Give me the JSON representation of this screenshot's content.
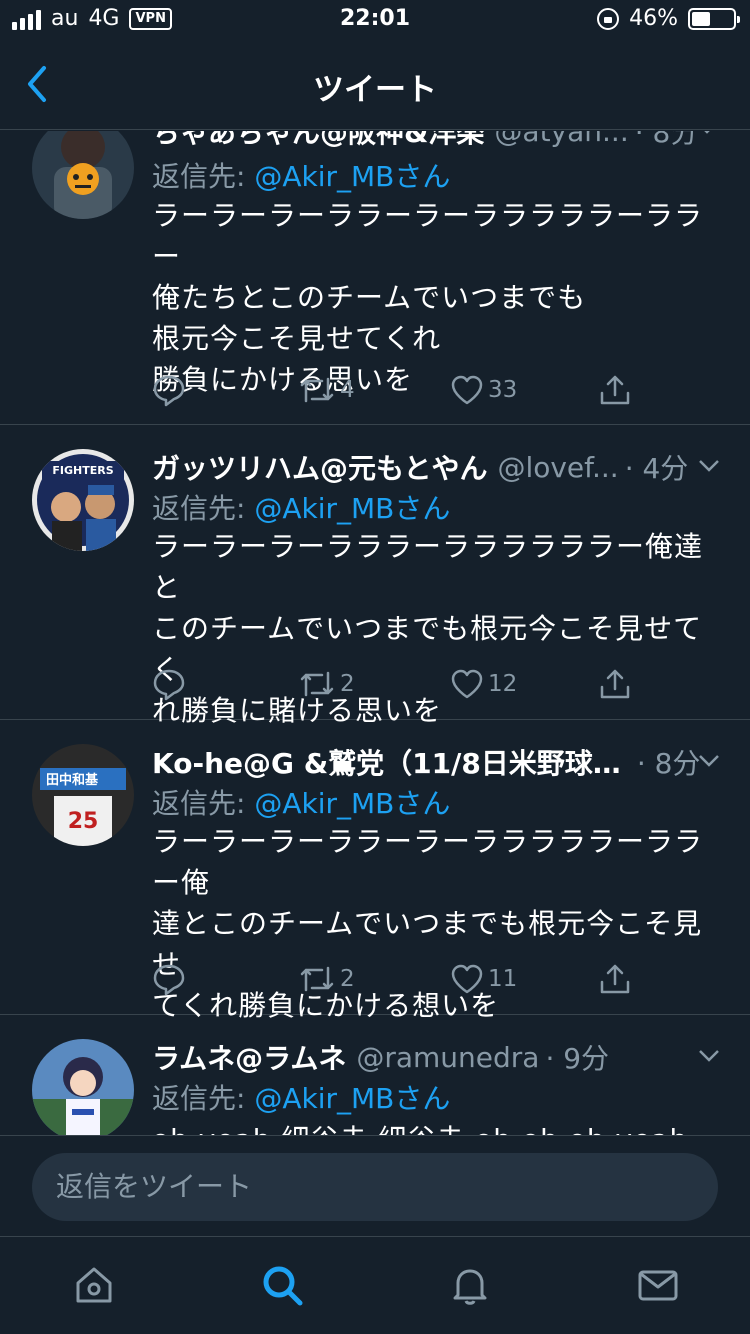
{
  "status": {
    "carrier": "au",
    "network": "4G",
    "vpn": "VPN",
    "time": "22:01",
    "battery_percent": "46%",
    "battery_level": 0.46
  },
  "nav": {
    "title": "ツイート"
  },
  "tweets": [
    {
      "name": "ちゃあちゃん@阪神&洋楽",
      "handle": "@atyan...",
      "time": "· 8分",
      "reply_prefix": "返信先:",
      "reply_to": "@Akir_MBさん",
      "text": "ラーラーラーララーラーラララララーララー\n俺たちとこのチームでいつまでも\n根元今こそ見せてくれ\n勝負にかける思いを",
      "retweets": "4",
      "likes": "33"
    },
    {
      "name": "ガッツリハム@元もとやん",
      "handle": "@lovef...",
      "time": "· 4分",
      "reply_prefix": "返信先:",
      "reply_to": "@Akir_MBさん",
      "text": "ラーラーラーラララーララララララー俺達と\nこのチームでいつまでも根元今こそ見せてく\nれ勝負に賭ける思いを",
      "retweets": "2",
      "likes": "12"
    },
    {
      "name": "Ko-he@G &鷲党（11/8日米野球…",
      "handle": "",
      "time": "· 8分",
      "reply_prefix": "返信先:",
      "reply_to": "@Akir_MBさん",
      "text": "ラーラーラーララーラーラララララーララー俺\n達とこのチームでいつまでも根元今こそ見せ\nてくれ勝負にかける想いを",
      "retweets": "2",
      "likes": "11"
    },
    {
      "name": "ラムネ@ラムネ",
      "handle": "@ramunedra",
      "time": "· 9分",
      "reply_prefix": "返信先:",
      "reply_to": "@Akir_MBさん",
      "text": "oh yeah 細谷圭 細谷圭 oh oh oh yeah 細",
      "retweets": "",
      "likes": ""
    }
  ],
  "compose": {
    "placeholder": "返信をツイート"
  },
  "tabs": [
    "home",
    "search",
    "notifications",
    "messages"
  ],
  "colors": {
    "background": "#15202b",
    "accent": "#1da1f2",
    "secondary_text": "#8899a6",
    "divider": "#38444d",
    "input": "#253341"
  }
}
